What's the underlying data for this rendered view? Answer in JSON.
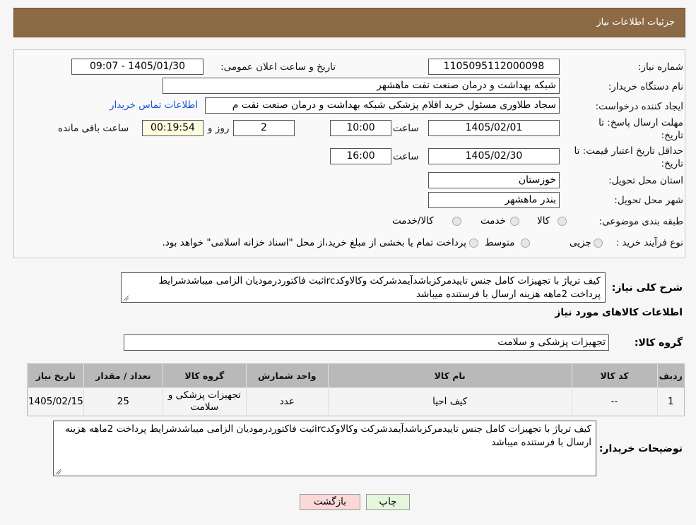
{
  "header": {
    "title": "جزئیات اطلاعات نیاز"
  },
  "form": {
    "need_number_label": "شماره نیاز:",
    "need_number": "1105095112000098",
    "announce_label": "تاریخ و ساعت اعلان عمومی:",
    "announce_value": "1405/01/30 - 09:07",
    "buyer_org_label": "نام دستگاه خریدار:",
    "buyer_org": "شبکه بهداشت و درمان صنعت نفت ماهشهر",
    "requester_label": "ایجاد کننده درخواست:",
    "requester": "سجاد طلاوری مسئول خرید اقلام پزشکی شبکه بهداشت و درمان صنعت نفت م",
    "contact_link": "اطلاعات تماس خریدار",
    "deadline_label_1": "مهلت ارسال پاسخ: تا",
    "deadline_label_2": "تاریخ:",
    "deadline_date": "1405/02/01",
    "time_label": "ساعت",
    "deadline_time": "10:00",
    "days_value": "2",
    "days_label": "روز و",
    "remaining_value": "00:19:54",
    "remaining_label": "ساعت باقی مانده",
    "validity_label_1": "حداقل تاریخ اعتبار قیمت: تا",
    "validity_label_2": "تاریخ:",
    "validity_date": "1405/02/30",
    "validity_time": "16:00",
    "province_label": "استان محل تحویل:",
    "province": "خوزستان",
    "city_label": "شهر محل تحویل:",
    "city": "بندر ماهشهر",
    "category_label": "طبقه بندی موضوعی:",
    "category_options": [
      "کالا",
      "خدمت",
      "کالا/خدمت"
    ],
    "process_label": "نوع فرآیند خرید :",
    "process_options": [
      "جزیی",
      "متوسط"
    ],
    "process_note": "پرداخت تمام یا بخشی از مبلغ خرید،از محل \"اسناد خزانه اسلامی\" خواهد بود."
  },
  "description": {
    "label": "شرح کلی نیاز:",
    "text": "کیف ترياژ با تجهيزات کامل جنس تاييدمرکزباشدآيمدشرکت وکالاوکدircثبت فاکتوردرموديان الزامی ميباشدشرايط پرداخت 2ماهه هزينه ارسال با فرستنده ميباشد"
  },
  "goods_section": {
    "title": "اطلاعات کالاهای مورد نیاز",
    "group_label": "گروه کالا:",
    "group_value": "تجهیزات پزشکی و سلامت"
  },
  "table": {
    "headers": [
      "ردیف",
      "کد کالا",
      "نام کالا",
      "واحد شمارش",
      "گروه کالا",
      "تعداد / مقدار",
      "تاریخ نیاز"
    ],
    "rows": [
      [
        "1",
        "--",
        "کیف احیا",
        "عدد",
        "تجهیزات پزشکی و سلامت",
        "25",
        "1405/02/15"
      ]
    ]
  },
  "buyer_notes": {
    "label": "توضیحات خریدار:",
    "text": "کیف ترياژ با تجهيزات کامل جنس تاييدمرکزباشدآيمدشرکت وکالاوکدircثبت فاکتوردرموديان الزامی ميباشدشرايط پرداخت 2ماهه هزينه ارسال با فرستنده ميباشد"
  },
  "buttons": {
    "print": "چاپ",
    "back": "بازگشت"
  },
  "colors": {
    "header_bg": "#8b6a45",
    "link": "#1a4fd8",
    "back_btn": "#fbd9d9",
    "print_btn": "#e4f7dc"
  }
}
